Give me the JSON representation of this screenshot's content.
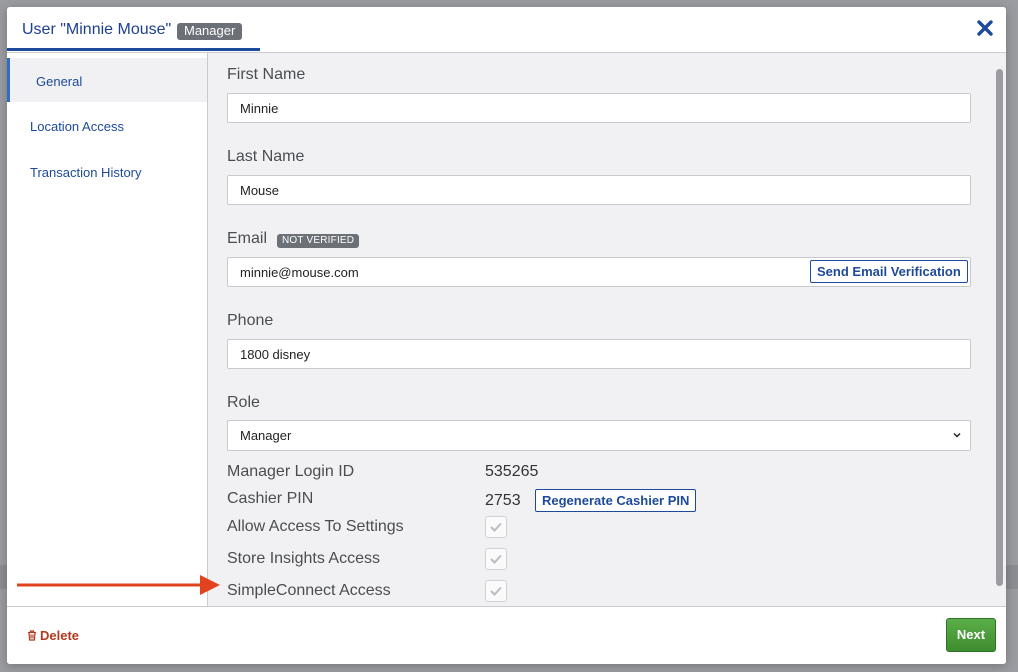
{
  "modal": {
    "title": "User \"Minnie Mouse\"",
    "role_badge": "Manager"
  },
  "sidebar": {
    "items": [
      {
        "label": "General"
      },
      {
        "label": "Location Access"
      },
      {
        "label": "Transaction History"
      }
    ]
  },
  "form": {
    "first_name": {
      "label": "First Name",
      "value": "Minnie"
    },
    "last_name": {
      "label": "Last Name",
      "value": "Mouse"
    },
    "email": {
      "label": "Email",
      "badge": "NOT VERIFIED",
      "value": "minnie@mouse.com",
      "verify_button": "Send Email Verification"
    },
    "phone": {
      "label": "Phone",
      "value": "1800 disney"
    },
    "role": {
      "label": "Role",
      "value": "Manager"
    },
    "manager_login_id": {
      "label": "Manager Login ID",
      "value": "535265"
    },
    "cashier_pin": {
      "label": "Cashier PIN",
      "value": "2753",
      "regen_button": "Regenerate Cashier PIN"
    },
    "permissions": [
      {
        "label": "Allow Access To Settings",
        "checked": true
      },
      {
        "label": "Store Insights Access",
        "checked": true
      },
      {
        "label": "SimpleConnect Access",
        "checked": true
      }
    ]
  },
  "footer": {
    "delete_label": "Delete",
    "next_label": "Next"
  },
  "colors": {
    "accent": "#1d4a9a",
    "delete": "#b23a1f",
    "next": "#4a9a3a",
    "arrow": "#e2421e",
    "badge": "#6c7077"
  },
  "icons": [
    "close-icon",
    "chevron-down-icon",
    "checkmark-icon",
    "trash-icon",
    "arrow-right-icon"
  ]
}
